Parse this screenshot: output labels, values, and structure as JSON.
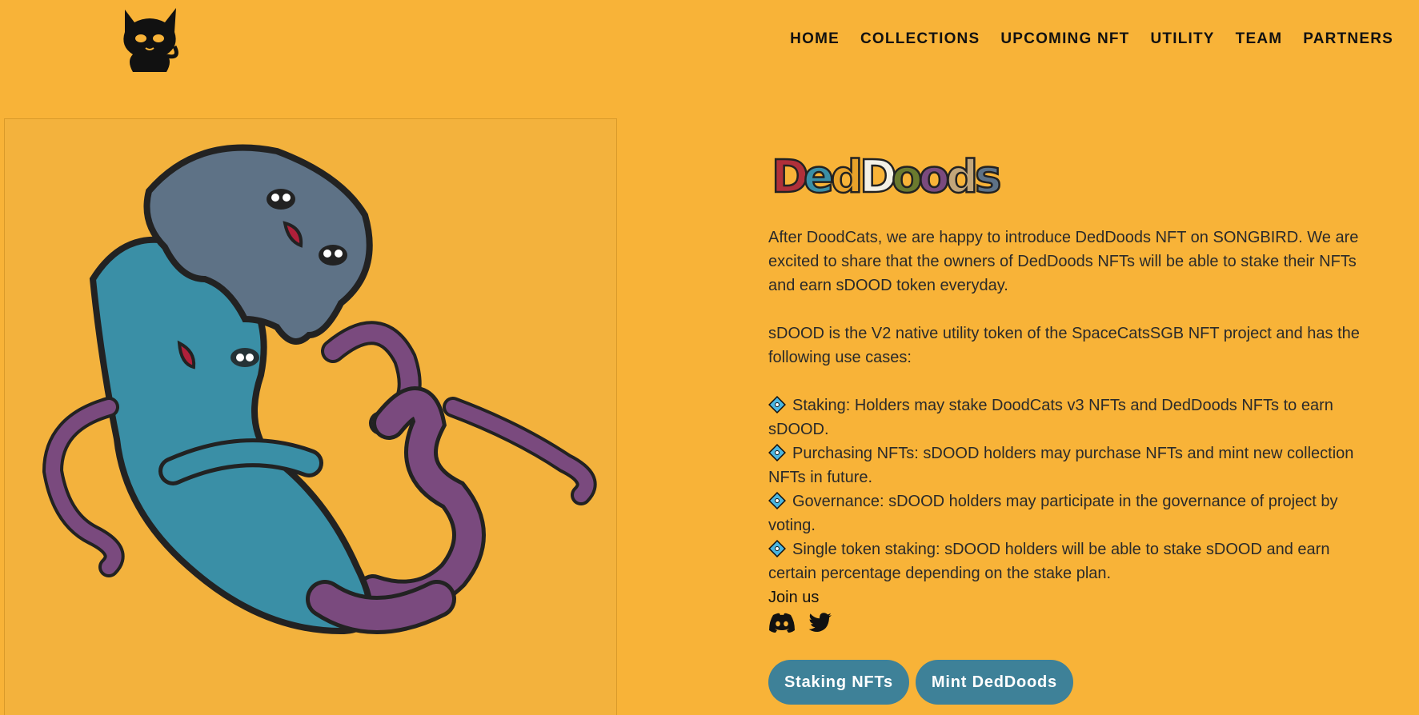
{
  "nav": {
    "items": [
      "HOME",
      "COLLECTIONS",
      "UPCOMING NFT",
      "UTILITY",
      "TEAM",
      "PARTNERS"
    ]
  },
  "logo_icon": "black-cat-icon",
  "title_logo_text": "DedDoods",
  "content": {
    "intro": "After DoodCats, we are happy to introduce DedDoods NFT on SONGBIRD. We are excited to share that the owners of DedDoods NFTs will be able to stake their NFTs and earn sDOOD token everyday.",
    "token_desc": "sDOOD is the V2 native utility token of the SpaceCatsSGB NFT project and has the following use cases:",
    "use_cases": [
      "Staking: Holders may stake DoodCats v3 NFTs and DedDoods NFTs to earn sDOOD.",
      "Purchasing NFTs: sDOOD holders may purchase NFTs and mint new collection NFTs in future.",
      "Governance: sDOOD holders may participate in the governance of project by voting.",
      "Single token staking: sDOOD holders will be able to stake sDOOD and earn certain percentage depending on the stake plan."
    ],
    "join_label": "Join us"
  },
  "socials": [
    "discord-icon",
    "twitter-icon"
  ],
  "buttons": {
    "staking": "Staking NFTs",
    "mint": "Mint DedDoods"
  },
  "colors": {
    "background": "#F8B338",
    "button": "#3E8198",
    "accent_purple": "#7A4A7E",
    "accent_teal": "#3A8FA6"
  }
}
